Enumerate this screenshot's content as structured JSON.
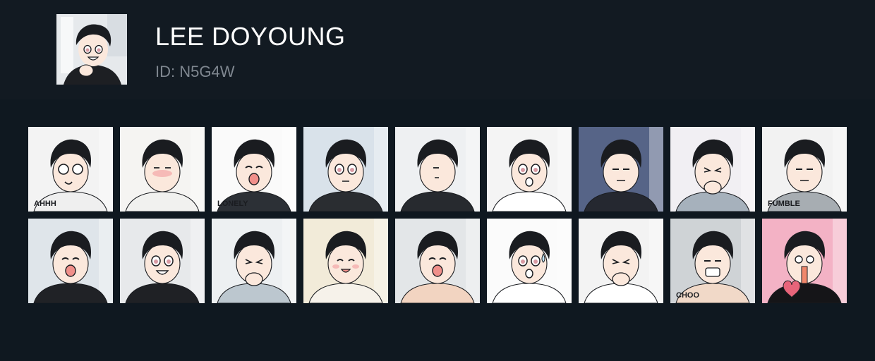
{
  "profile": {
    "name": "LEE DOYOUNG",
    "id_text": "ID: N5G4W",
    "avatar_icon": "character-avatar-icon"
  },
  "colors": {
    "page_bg": "#0f1820",
    "header_bg": "#121a22",
    "title": "#ffffff",
    "subtitle": "#7f8790"
  },
  "stickers": [
    {
      "icon": "sticker-dizzy-icon",
      "bg": "#f3f3f3",
      "shirt": "#efefef",
      "face": "dizzy",
      "text": "AHHH"
    },
    {
      "icon": "sticker-blushing-icon",
      "bg": "#f5f4f2",
      "shirt": "#f1f1ef",
      "face": "blush",
      "text": ""
    },
    {
      "icon": "sticker-cheering-icon",
      "bg": "#fafafa",
      "shirt": "#2c3036",
      "face": "shout",
      "text": "LONELY"
    },
    {
      "icon": "sticker-round-eyes-icon",
      "bg": "#d9e2ea",
      "shirt": "#2a2d31",
      "face": "round",
      "text": ""
    },
    {
      "icon": "sticker-peeking-icon",
      "bg": "#eef0f2",
      "shirt": "#272a2f",
      "face": "peek",
      "text": ""
    },
    {
      "icon": "sticker-shocked-icon",
      "bg": "#f4f4f4",
      "shirt": "#ffffff",
      "face": "shock",
      "text": ""
    },
    {
      "icon": "sticker-speechless-icon",
      "bg": "#566487",
      "shirt": "#252830",
      "face": "plain",
      "text": ""
    },
    {
      "icon": "sticker-nervous-icon",
      "bg": "#f1eff3",
      "shirt": "#a6b1bc",
      "face": "nervous",
      "text": ""
    },
    {
      "icon": "sticker-grumpy-icon",
      "bg": "#f2f2f2",
      "shirt": "#a7adb2",
      "face": "grumpy",
      "text": "FUMBLE"
    },
    {
      "icon": "sticker-laughing-icon",
      "bg": "#dfe5ea",
      "shirt": "#202226",
      "face": "laugh",
      "text": ""
    },
    {
      "icon": "sticker-grinning-icon",
      "bg": "#e7e9eb",
      "shirt": "#1f2125",
      "face": "grin",
      "text": ""
    },
    {
      "icon": "sticker-excited-icon",
      "bg": "#edf0f2",
      "shirt": "#bcc7cf",
      "face": "excited",
      "text": ""
    },
    {
      "icon": "sticker-towel-icon",
      "bg": "#f2ebd9",
      "shirt": "#f6f2ea",
      "face": "happy",
      "text": ""
    },
    {
      "icon": "sticker-bath-icon",
      "bg": "#e3e6e8",
      "shirt": "#f2d4c1",
      "face": "gasp",
      "text": ""
    },
    {
      "icon": "sticker-sweating-icon",
      "bg": "#fbfbfb",
      "shirt": "#ffffff",
      "face": "sweat",
      "text": ""
    },
    {
      "icon": "sticker-facepalm-icon",
      "bg": "#f3f3f3",
      "shirt": "#ffffff",
      "face": "palm",
      "text": ""
    },
    {
      "icon": "sticker-speechless-shadow-icon",
      "bg": "#cfd3d6",
      "shirt": "#f1d9c8",
      "face": "blank",
      "text": "CHOO"
    },
    {
      "icon": "sticker-love-icon",
      "bg": "#f3b2c5",
      "shirt": "#151518",
      "face": "love",
      "text": ""
    }
  ]
}
